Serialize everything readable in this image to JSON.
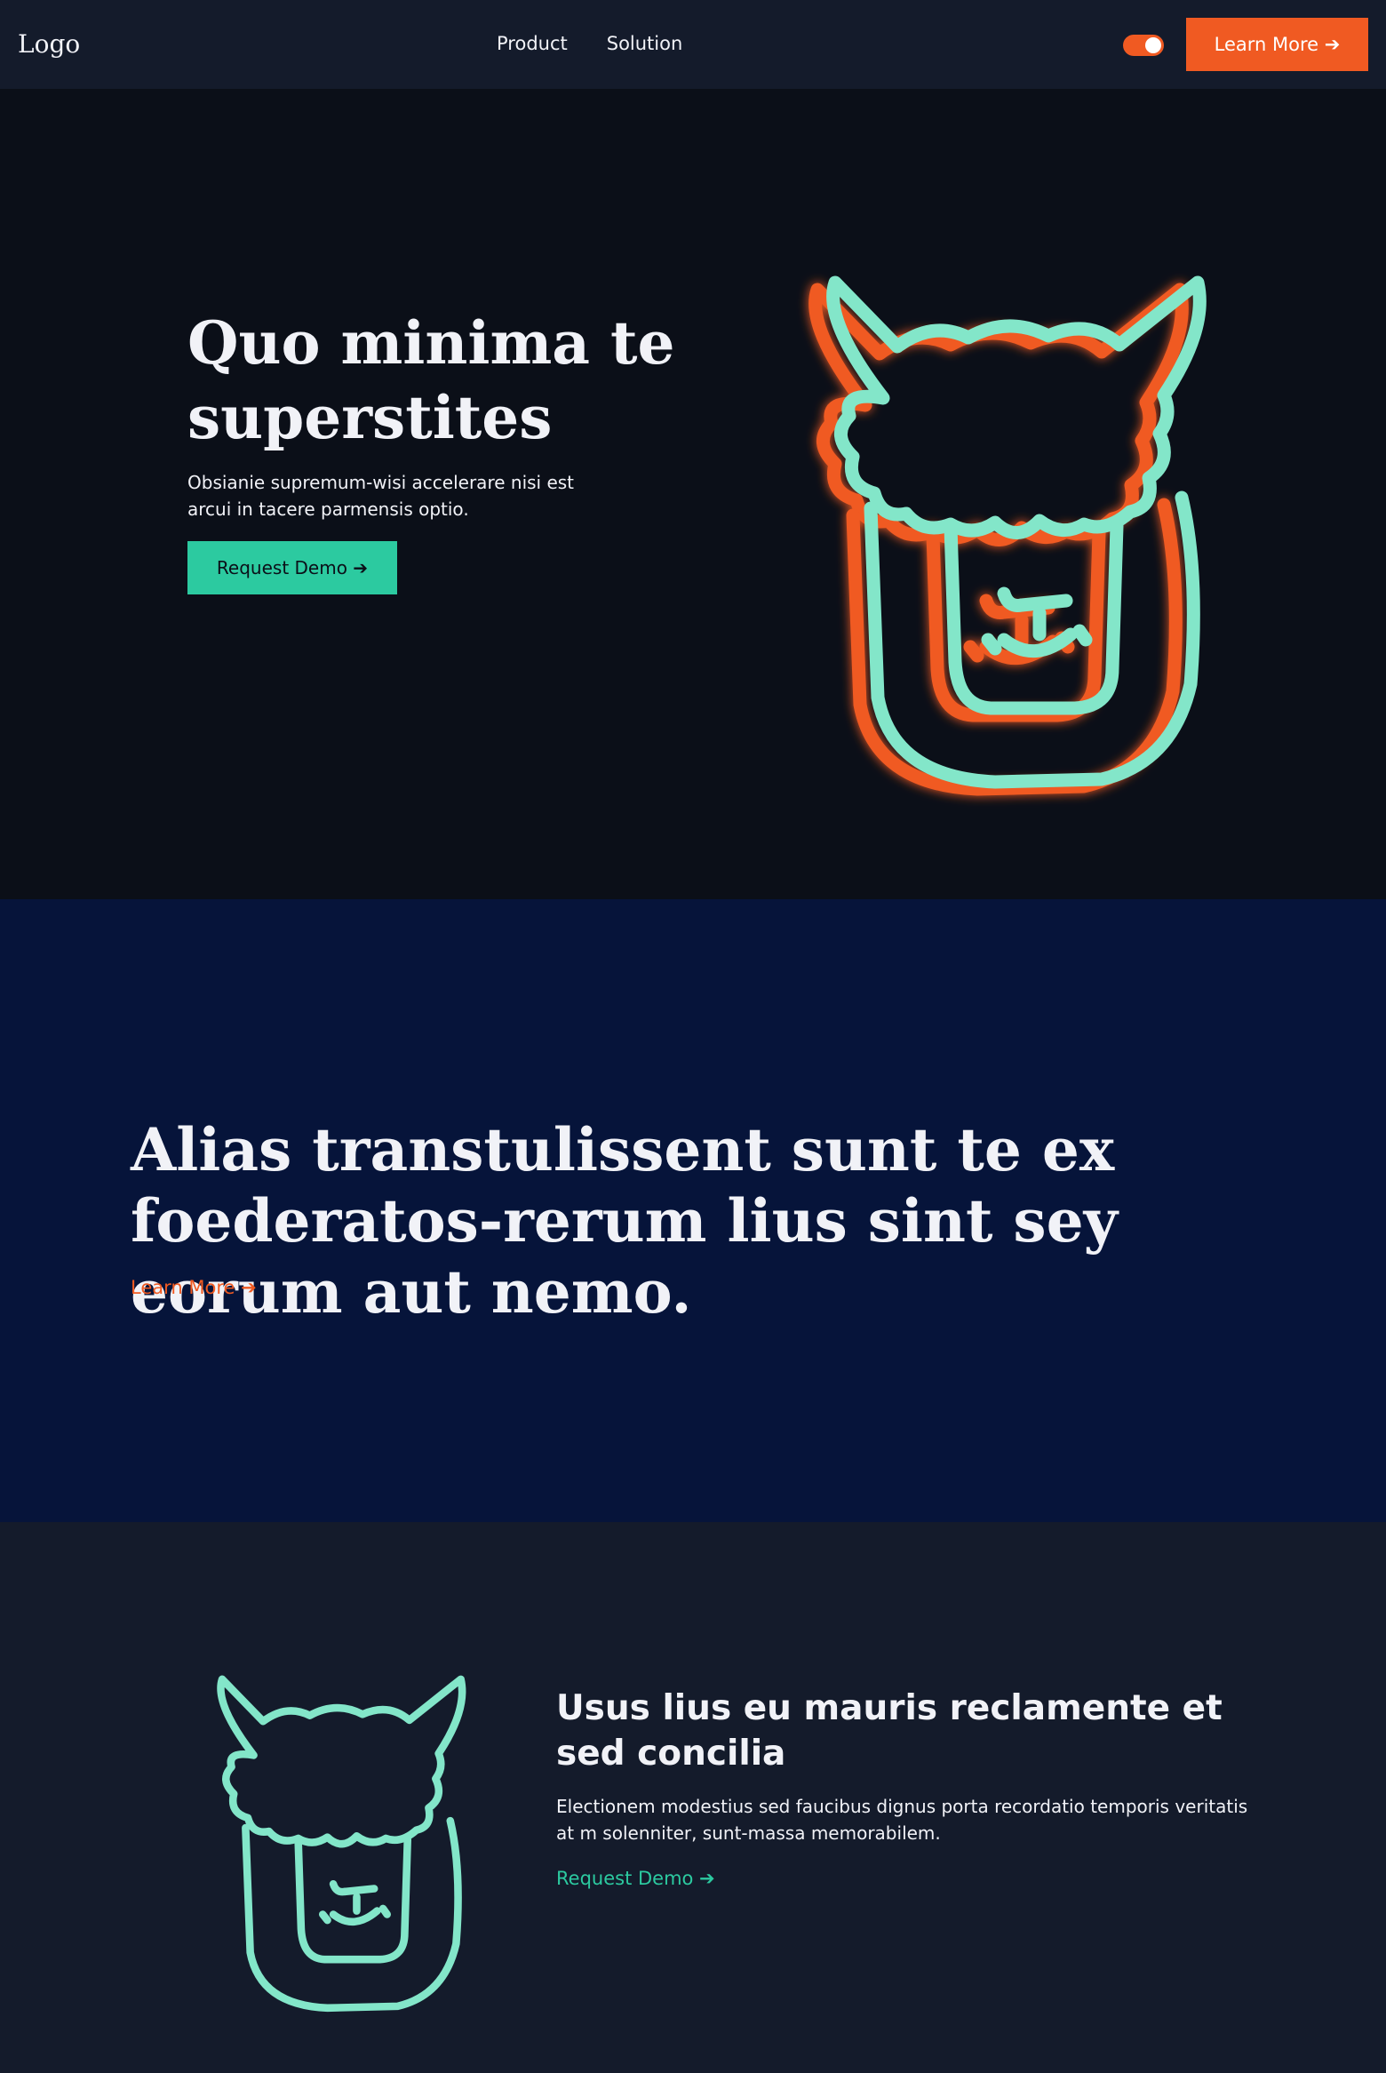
{
  "nav": {
    "logo": "Logo",
    "links": [
      "Product",
      "Solution"
    ],
    "cta_label": "Learn More ➔"
  },
  "hero": {
    "title": "Quo minima te superstites",
    "text": "Obsianie supremum-wisi accelerare nisi est arcui in tacere parmensis optio.",
    "button_label": "Request Demo ➔"
  },
  "quote": {
    "title": "Alias transtulissent sunt te ex foederatos-rerum lius sint sey eorum aut nemo.",
    "link_label": "Learn More ➔"
  },
  "feature": {
    "title": "Usus lius eu mauris reclamente et sed concilia",
    "text": "Electionem modestius sed faucibus dignus porta recordatio temporis veritatis at m solenniter, sunt-massa memorabilem.",
    "link_label": "Request Demo ➔"
  },
  "colors": {
    "accent": "#f05a22",
    "teal": "#2ccaa0",
    "mint": "#83e6c9",
    "navy": "#06143a",
    "dark": "#0b0f18"
  },
  "icons": {
    "hero_illustration": "llama-icon",
    "feature_illustration": "llama-icon"
  }
}
